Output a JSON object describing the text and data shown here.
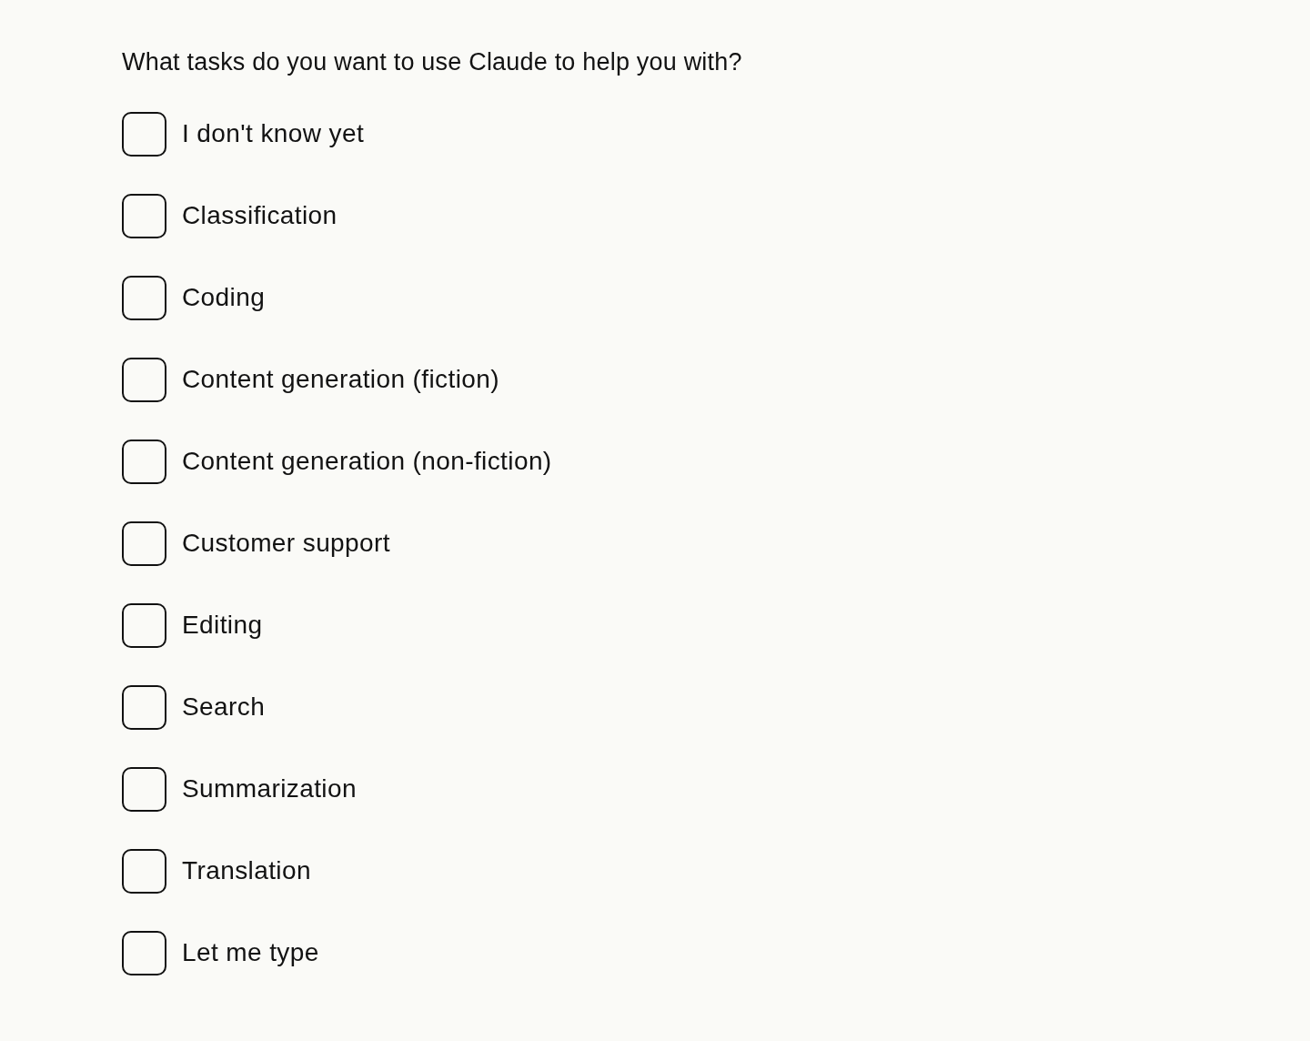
{
  "question": "What tasks do you want to use Claude to help you with?",
  "options": [
    {
      "label": "I don't know yet",
      "checked": false
    },
    {
      "label": "Classification",
      "checked": false
    },
    {
      "label": "Coding",
      "checked": false
    },
    {
      "label": "Content generation (fiction)",
      "checked": false
    },
    {
      "label": "Content generation (non-fiction)",
      "checked": false
    },
    {
      "label": "Customer support",
      "checked": false
    },
    {
      "label": "Editing",
      "checked": false
    },
    {
      "label": "Search",
      "checked": false
    },
    {
      "label": "Summarization",
      "checked": false
    },
    {
      "label": "Translation",
      "checked": false
    },
    {
      "label": "Let me type",
      "checked": false
    }
  ]
}
